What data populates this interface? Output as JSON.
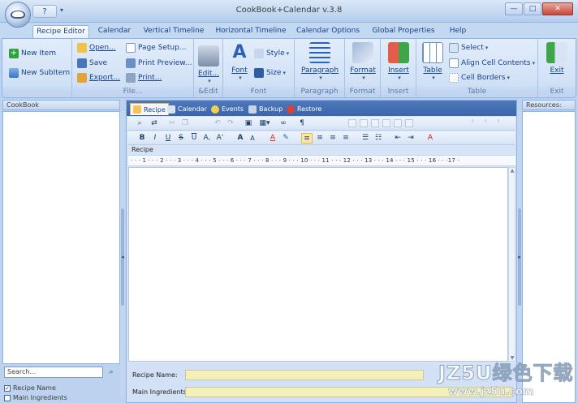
{
  "window": {
    "title": "CookBook+Calendar v.3.8",
    "controls": [
      "—",
      "□",
      "✕"
    ]
  },
  "qat": {
    "icon": "help-icon",
    "glyph": "?"
  },
  "ribbon_tabs": [
    "Recipe Editor",
    "Calendar",
    "Vertical Timeline",
    "Horizontal Timeline",
    "Calendar Options",
    "Global Properties",
    "Help"
  ],
  "active_tab": "Recipe Editor",
  "ribbon": {
    "groups": {
      "items": "",
      "file": "File...",
      "edit": "&Edit",
      "font": "Font",
      "paragraph": "Paragraph",
      "format": "Format",
      "insert": "Insert",
      "table": "Table",
      "exit": "Exit"
    },
    "new_item": "New Item",
    "new_subitem": "New SubItem",
    "open": "Open...",
    "save": "Save",
    "export": "Export...",
    "page_setup": "Page Setup...",
    "print_preview": "Print Preview...",
    "print": "Print...",
    "edit": "Edit...",
    "font": "Font",
    "style": "Style",
    "size": "Size",
    "paragraph": "Paragraph",
    "format": "Format",
    "insert": "Insert",
    "table": "Table",
    "select": "Select",
    "align_cell_contents": "Align Cell Contents",
    "cell_borders": "Cell Borders",
    "exit": "Exit"
  },
  "left_pane": {
    "header": "CookBook",
    "search_placeholder": "Search...",
    "checkboxes": [
      {
        "label": "Recipe Name",
        "checked": true
      },
      {
        "label": "Main Ingredients",
        "checked": false
      }
    ]
  },
  "editor_tabs": [
    "Recipe",
    "Calendar",
    "Events",
    "Backup",
    "Restore"
  ],
  "editor": {
    "doc_label": "Recipe",
    "ruler": "· · · 1 · · · 2 · · · 3 · · · 4 · · · 5 · · · 6 · · · 7 · · · 8 · · · 9 · · · 10 · · · 11 · · · 12 · · · 13 · · · 14 · · · 15 · · · 16 · · ·17 ·",
    "fields": [
      {
        "label": "Recipe Name:",
        "value": ""
      },
      {
        "label": "Main Ingredients:",
        "value": ""
      }
    ]
  },
  "right_pane": {
    "header": "Resources:"
  },
  "watermark": {
    "line1": "JZ5U绿色下载",
    "line2": "www.jz5u.com"
  },
  "colors": {
    "ribbon_bg": "#d2e2f6",
    "editor_tab_bar": "#3a66ad",
    "field_bg": "#f5f0b8",
    "accent": "#15428b"
  }
}
